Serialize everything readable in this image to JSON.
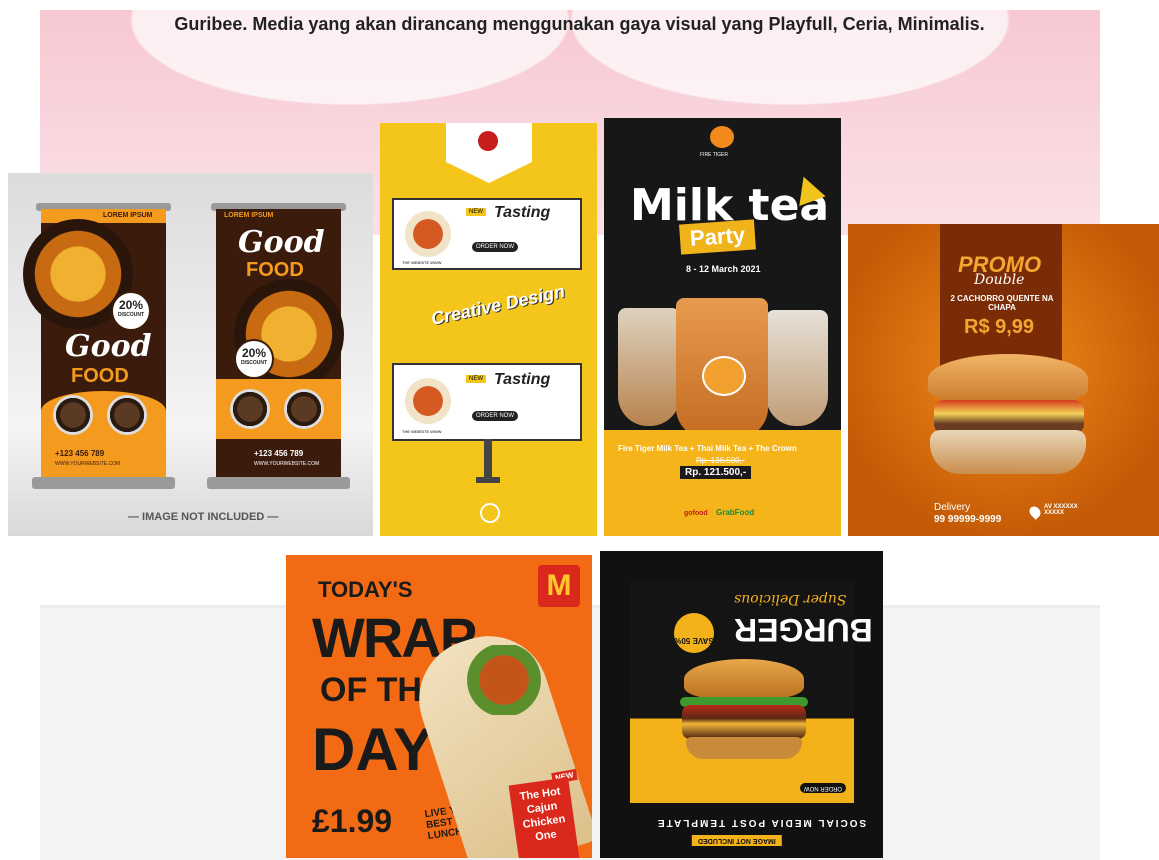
{
  "caption": "Guribee. Media yang akan dirancang menggunakan gaya visual yang Playfull, Ceria, Minimalis.",
  "card1": {
    "brand": "LOREM IPSUM",
    "headline1": "Good",
    "headline2": "FOOD",
    "discount_value": "20%",
    "discount_label": "DISCOUNT",
    "phone": "+123 456 789",
    "website": "WWW.YOURWEBSITE.COM",
    "note": "— IMAGE NOT INCLUDED —"
  },
  "card2": {
    "script_word": "Tasting",
    "promo_tag": "NEW",
    "cta_label": "ORDER NOW",
    "website": "THE WEBSITE.WWW",
    "center_script": "Creative Design"
  },
  "card3": {
    "logo_text": "FIRE TIGER",
    "title": "Milk tea",
    "subtitle": "Party",
    "dates": "8 - 12 March 2021",
    "products": "Fire Tiger Milk Tea + Thai Milk Tea + The Crown",
    "old_price": "Rp. 136.500,-",
    "new_price": "Rp. 121.500,-",
    "app1": "gofood",
    "app2": "GrabFood"
  },
  "card4": {
    "title": "PROMO",
    "script": "Double",
    "offer": "2 CACHORRO QUENTE NA CHAPA",
    "price": "R$ 9,99",
    "delivery_label": "Delivery",
    "phone": "99 99999-9999",
    "address": "AV XXXXXX XXXXX"
  },
  "card5": {
    "line1": "TODAY'S",
    "line2": "WRAP",
    "line3": "OF THE",
    "line4": "DAY",
    "price": "£1.99",
    "tagline": "LIVE YOUR BEST LUNCH",
    "badge_new": "NEW",
    "product": "The Hot Cajun Chicken One",
    "brand_mark": "M"
  },
  "card6": {
    "script": "Super Delicious",
    "title": "BURGER",
    "save": "SAVE 50%",
    "order": "ORDER NOW",
    "template_label": "SOCIAL MEDIA POST TEMPLATE",
    "note": "IMAGE NOT INCLUDED"
  },
  "colors": {
    "orange": "#f39a1f",
    "brown": "#3a1b0c",
    "yellow": "#f4c51a",
    "mcd_red": "#da291c"
  }
}
